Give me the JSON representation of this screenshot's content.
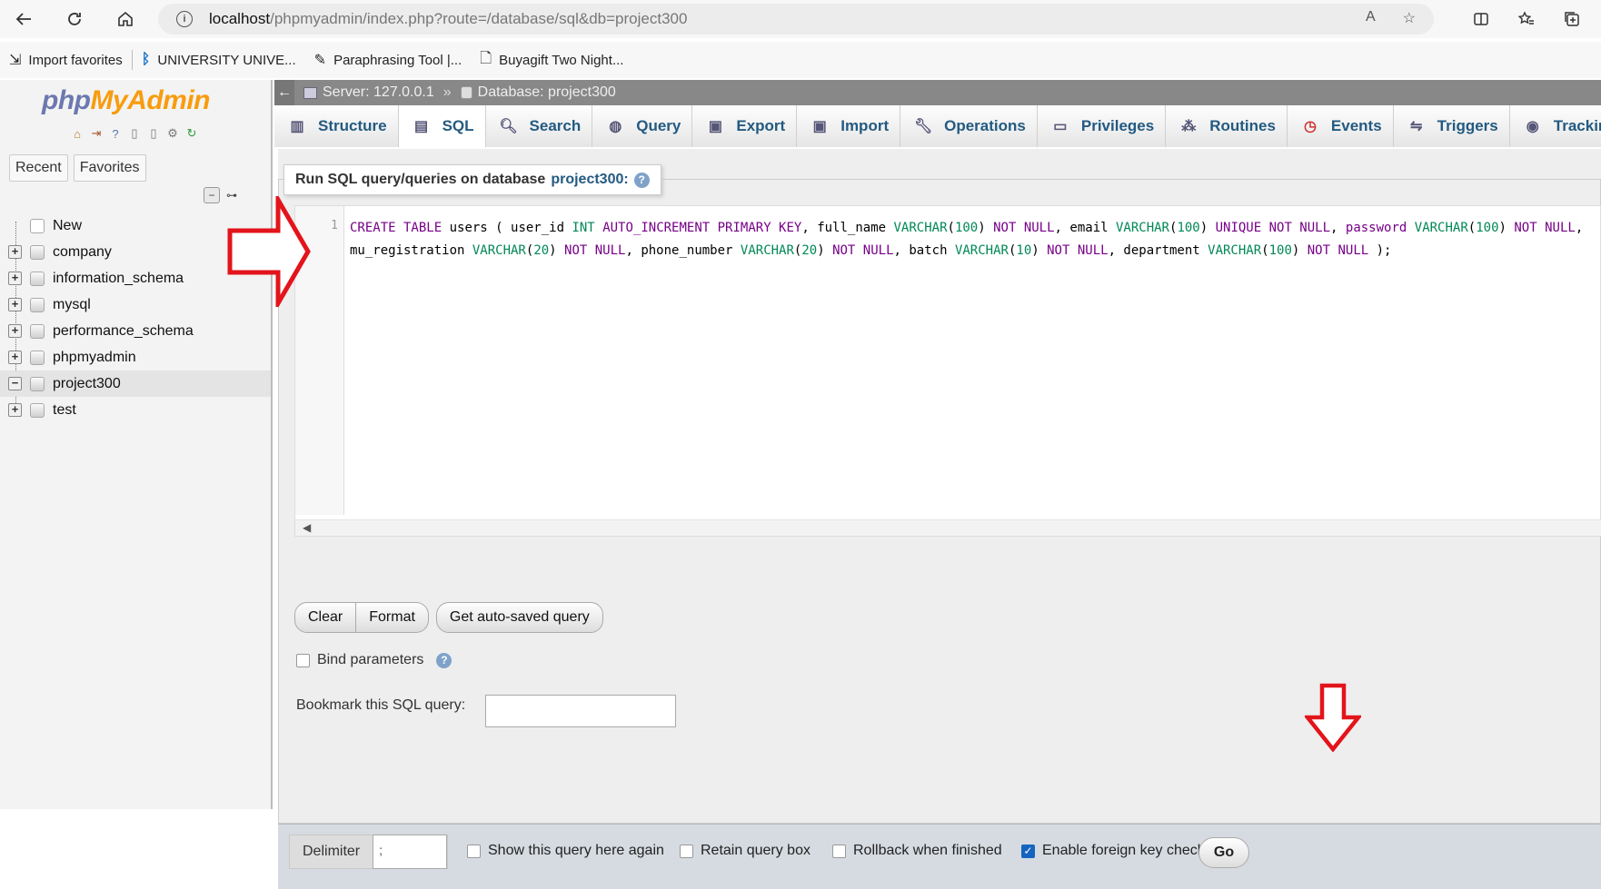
{
  "browser": {
    "url_host": "localhost",
    "url_path": "/phpmyadmin/index.php?route=/database/sql&db=project300",
    "favorites": [
      "Import favorites",
      "UNIVERSITY UNIVE...",
      "Paraphrasing Tool |...",
      "Buyagift Two Night..."
    ]
  },
  "nav": {
    "logo_php": "php",
    "logo_my": "MyAdmin",
    "tab_recent": "Recent",
    "tab_favorites": "Favorites",
    "items": [
      {
        "label": "New"
      },
      {
        "label": "company"
      },
      {
        "label": "information_schema"
      },
      {
        "label": "mysql"
      },
      {
        "label": "performance_schema"
      },
      {
        "label": "phpmyadmin"
      },
      {
        "label": "project300"
      },
      {
        "label": "test"
      }
    ]
  },
  "breadcrumb": {
    "server": "Server: 127.0.0.1",
    "separator": "»",
    "database": "Database: project300"
  },
  "tabs": [
    "Structure",
    "SQL",
    "Search",
    "Query",
    "Export",
    "Import",
    "Operations",
    "Privileges",
    "Routines",
    "Events",
    "Triggers",
    "Tracking"
  ],
  "sql": {
    "legend_prefix": "Run SQL query/queries on database",
    "legend_db": "project300:",
    "line_number": "1",
    "buttons": {
      "clear": "Clear",
      "format": "Format",
      "autosave": "Get auto-saved query"
    },
    "bind_parameters": "Bind parameters",
    "bookmark_label": "Bookmark this SQL query:",
    "bookmark_value": ""
  },
  "bottom": {
    "delimiter_label": "Delimiter",
    "delimiter_value": ";",
    "show_query": "Show this query here again",
    "retain_box": "Retain query box",
    "rollback": "Rollback when finished",
    "fk_checks": "Enable foreign key checks",
    "go": "Go"
  },
  "colors": {
    "annotation_arrow": "#e3141b",
    "link": "#235a81"
  }
}
